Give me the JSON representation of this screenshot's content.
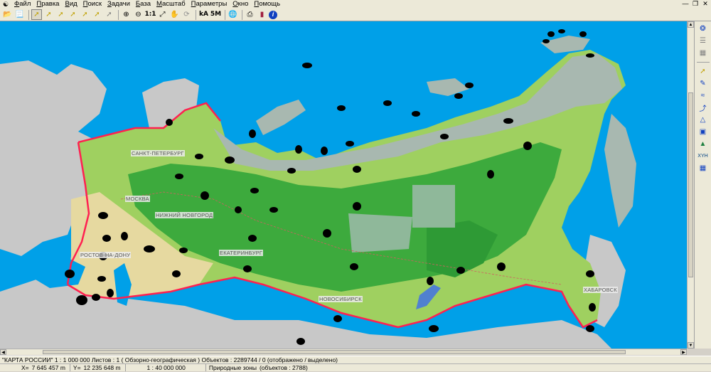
{
  "menu": {
    "items": [
      "Файл",
      "Правка",
      "Вид",
      "Поиск",
      "Задачи",
      "База",
      "Масштаб",
      "Параметры",
      "Окно",
      "Помощь"
    ]
  },
  "toolbar": {
    "scale_1_1": "1:1",
    "text_tool": "kA",
    "label_tool": "5M"
  },
  "map": {
    "cities": {
      "spb": "САНКТ-ПЕТЕРБУРГ",
      "moscow": "МОСКВА",
      "nnovgorod": "НИЖНИЙ НОВГОРОД",
      "rostov": "РОСТОВ-НА-ДОНУ",
      "ekb": "ЕКАТЕРИНБУРГ",
      "novosibirsk": "НОВОСИБИРСК",
      "khabarovsk": "ХАБАРОВСК"
    },
    "colors": {
      "sea": "#00a0e8",
      "foreign_land": "#c8c8c8",
      "tundra": "#a8b8b0",
      "forest": "#3daa3d",
      "light_forest": "#9fd060",
      "steppe": "#e6d9a0",
      "border": "#ff2050"
    }
  },
  "statusbar": {
    "line1": "\"КАРТА РОССИИ\"  1 : 1 000 000   Листов : 1   ( Обзорно-географическая )  Объектов : 2289744 / 0 (отображено / выделено)",
    "x_label": "X=",
    "x_value": "7 645 457 m",
    "y_label": "Y=",
    "y_value": "12 235 648 m",
    "scale": "1 : 40 000 000",
    "layer": "Природные зоны",
    "layer_count": "(объектов : 2788)"
  }
}
